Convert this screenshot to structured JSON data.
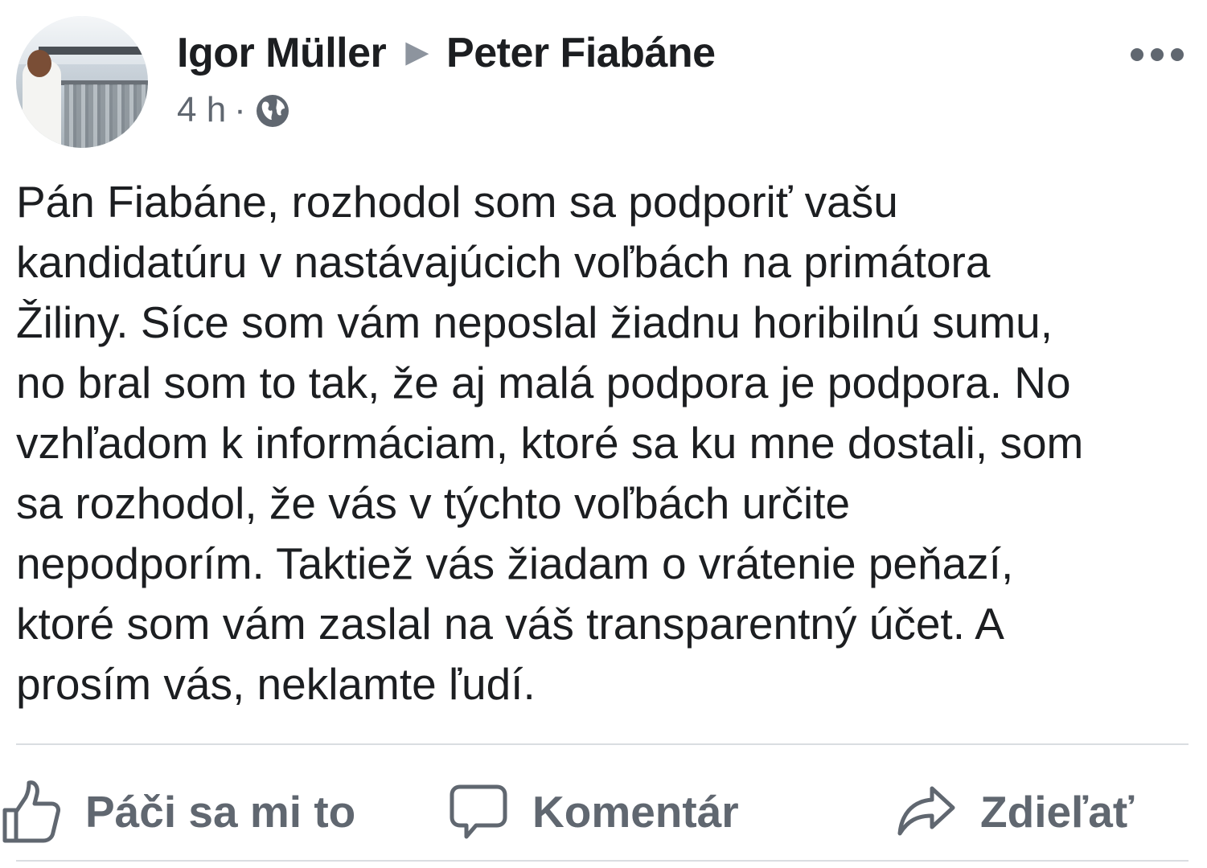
{
  "post": {
    "author": "Igor Müller",
    "target": "Peter Fiabáne",
    "time": "4 h",
    "separator": "·",
    "privacy_icon": "globe-icon",
    "more_icon": "more-options-icon",
    "body": "Pán Fiabáne, rozhodol som sa podporiť vašu\nkandidatúru v nastávajúcich voľbách na primátora\nŽiliny. Síce som vám neposlal žiadnu horibilnú sumu,\nno bral som to tak, že aj malá podpora je podpora. No\nvzhľadom k informáciam, ktoré sa ku mne dostali, som\nsa rozhodol, že vás v týchto voľbách určite\nnepodporím. Taktiež vás žiadam o vrátenie peňazí,\nktoré som vám zaslal na váš transparentný účet. A\nprosím vás, neklamte ľudí."
  },
  "actions": {
    "like_label": "Páči sa mi to",
    "comment_label": "Komentár",
    "share_label": "Zdieľať"
  },
  "colors": {
    "text": "#1c1e21",
    "secondary": "#606770",
    "divider": "#dadde1"
  }
}
